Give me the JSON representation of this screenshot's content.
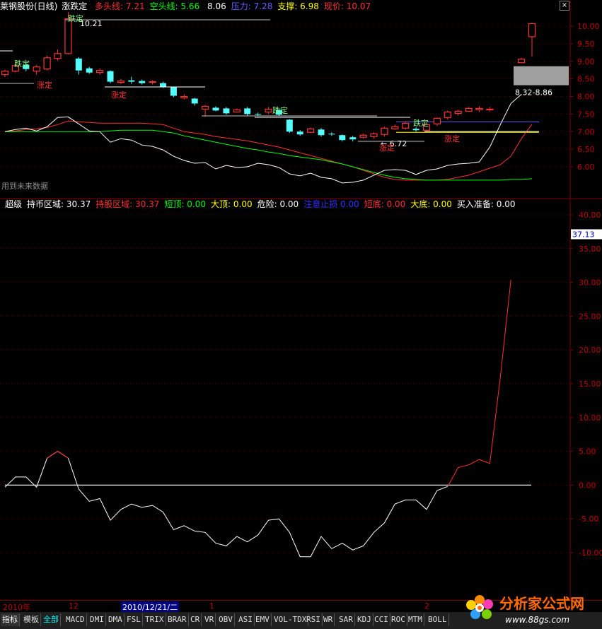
{
  "header": {
    "title": "莱钢股份(日线)",
    "indicator": "涨跌定",
    "items": [
      {
        "label": "多头线:",
        "value": "7.21",
        "color": "#ff3030"
      },
      {
        "label": "空头线:",
        "value": "5.66",
        "color": "#00ff00"
      },
      {
        "label": "",
        "value": "8.06",
        "color": "#ffffff"
      },
      {
        "label": "压力:",
        "value": "7.28",
        "color": "#6060ff"
      },
      {
        "label": "支撑:",
        "value": "6.98",
        "color": "#ffff00"
      },
      {
        "label": "现价:",
        "value": "10.07",
        "color": "#ff3030"
      }
    ],
    "close_icon": "close-icon"
  },
  "lower_header": {
    "items": [
      {
        "label": "超级",
        "value": "",
        "color": "#ffffff"
      },
      {
        "label": "持币区域:",
        "value": "30.37",
        "color": "#ffffff"
      },
      {
        "label": "持股区域:",
        "value": "30.37",
        "color": "#ff3030"
      },
      {
        "label": "短顶:",
        "value": "0.00",
        "color": "#00ff00"
      },
      {
        "label": "大顶:",
        "value": "0.00",
        "color": "#ffff00"
      },
      {
        "label": "危险:",
        "value": "0.00",
        "color": "#ffffff"
      },
      {
        "label": "注意止损",
        "value": "0.00",
        "color": "#3030ff"
      },
      {
        "label": "短底:",
        "value": "0.00",
        "color": "#ff3030"
      },
      {
        "label": "大底:",
        "value": "0.00",
        "color": "#ffff00"
      },
      {
        "label": "买入准备:",
        "value": "0.00",
        "color": "#ffffff"
      }
    ]
  },
  "upper_labels": {
    "high_label": "10.21",
    "low_label": "6.72",
    "range_label": "8.32-8.86",
    "future_note": "用到未来数据",
    "up_fix": "涨定",
    "down_fix": "跌定"
  },
  "time_axis": {
    "labels": [
      "2010年",
      "12",
      "2010/12/21/二",
      "1",
      "2"
    ]
  },
  "tabs": [
    "指标",
    "模板",
    "全部",
    "MACD",
    "DMI",
    "DMA",
    "FSL",
    "TRIX",
    "BRAR",
    "CR",
    "VR",
    "OBV",
    "ASI",
    "EMV",
    "VOL-TDX",
    "RSI",
    "WR",
    "SAR",
    "KDJ",
    "CCI",
    "ROC",
    "MTM",
    "BOLL"
  ],
  "watermark": {
    "text": "分析家公式网",
    "url": "www.88gs.com"
  },
  "chart_data": [
    {
      "type": "candlestick",
      "title": "莱钢股份(日线)",
      "ylim": [
        5.3,
        10.45
      ],
      "yticks": [
        "10.00",
        "9.50",
        "9.00",
        "8.50",
        "8.00",
        "7.50",
        "7.00",
        "6.50",
        "6.00"
      ],
      "candles": [
        {
          "o": 8.62,
          "c": 8.72,
          "h": 8.76,
          "l": 8.55
        },
        {
          "o": 8.72,
          "c": 8.88,
          "h": 8.94,
          "l": 8.68
        },
        {
          "o": 8.9,
          "c": 8.78,
          "h": 8.96,
          "l": 8.72
        },
        {
          "o": 8.72,
          "c": 8.84,
          "h": 8.9,
          "l": 8.62
        },
        {
          "o": 8.78,
          "c": 9.1,
          "h": 9.16,
          "l": 8.74
        },
        {
          "o": 9.08,
          "c": 9.22,
          "h": 9.34,
          "l": 9.02
        },
        {
          "o": 9.22,
          "c": 10.21,
          "h": 10.4,
          "l": 9.2
        },
        {
          "o": 9.08,
          "c": 8.74,
          "h": 9.12,
          "l": 8.62
        },
        {
          "o": 8.8,
          "c": 8.68,
          "h": 8.84,
          "l": 8.64
        },
        {
          "o": 8.68,
          "c": 8.74,
          "h": 8.8,
          "l": 8.62
        },
        {
          "o": 8.72,
          "c": 8.42,
          "h": 8.74,
          "l": 8.38
        },
        {
          "o": 8.4,
          "c": 8.44,
          "h": 8.5,
          "l": 8.36
        },
        {
          "o": 8.46,
          "c": 8.42,
          "h": 8.56,
          "l": 8.36
        },
        {
          "o": 8.44,
          "c": 8.38,
          "h": 8.48,
          "l": 8.34
        },
        {
          "o": 8.4,
          "c": 8.42,
          "h": 8.46,
          "l": 8.34
        },
        {
          "o": 8.38,
          "c": 8.28,
          "h": 8.42,
          "l": 8.24
        },
        {
          "o": 8.26,
          "c": 8.02,
          "h": 8.28,
          "l": 7.98
        },
        {
          "o": 7.96,
          "c": 8.0,
          "h": 8.06,
          "l": 7.92
        },
        {
          "o": 7.94,
          "c": 7.8,
          "h": 7.96,
          "l": 7.74
        },
        {
          "o": 7.64,
          "c": 7.72,
          "h": 7.76,
          "l": 7.42
        },
        {
          "o": 7.68,
          "c": 7.6,
          "h": 7.72,
          "l": 7.58
        },
        {
          "o": 7.66,
          "c": 7.52,
          "h": 7.7,
          "l": 7.48
        },
        {
          "o": 7.56,
          "c": 7.62,
          "h": 7.66,
          "l": 7.54
        },
        {
          "o": 7.66,
          "c": 7.5,
          "h": 7.7,
          "l": 7.46
        },
        {
          "o": 7.5,
          "c": 7.48,
          "h": 7.54,
          "l": 7.44
        },
        {
          "o": 7.56,
          "c": 7.64,
          "h": 7.7,
          "l": 7.5
        },
        {
          "o": 7.62,
          "c": 7.48,
          "h": 7.64,
          "l": 7.44
        },
        {
          "o": 7.34,
          "c": 7.0,
          "h": 7.36,
          "l": 6.96
        },
        {
          "o": 7.0,
          "c": 6.92,
          "h": 7.04,
          "l": 6.88
        },
        {
          "o": 6.98,
          "c": 7.08,
          "h": 7.12,
          "l": 6.96
        },
        {
          "o": 7.06,
          "c": 6.9,
          "h": 7.1,
          "l": 6.86
        },
        {
          "o": 6.94,
          "c": 6.92,
          "h": 6.98,
          "l": 6.88
        },
        {
          "o": 6.9,
          "c": 6.76,
          "h": 6.92,
          "l": 6.72
        },
        {
          "o": 6.84,
          "c": 6.78,
          "h": 6.88,
          "l": 6.72
        },
        {
          "o": 6.84,
          "c": 6.9,
          "h": 6.94,
          "l": 6.8
        },
        {
          "o": 6.86,
          "c": 6.94,
          "h": 6.98,
          "l": 6.8
        },
        {
          "o": 6.92,
          "c": 7.1,
          "h": 7.14,
          "l": 6.86
        },
        {
          "o": 7.08,
          "c": 7.14,
          "h": 7.2,
          "l": 7.04
        },
        {
          "o": 7.1,
          "c": 7.24,
          "h": 7.3,
          "l": 7.06
        },
        {
          "o": 7.08,
          "c": 7.04,
          "h": 7.12,
          "l": 7.0
        },
        {
          "o": 7.04,
          "c": 7.2,
          "h": 7.28,
          "l": 7.0
        },
        {
          "o": 7.22,
          "c": 7.38,
          "h": 7.4,
          "l": 7.16
        },
        {
          "o": 7.4,
          "c": 7.56,
          "h": 7.6,
          "l": 7.34
        },
        {
          "o": 7.52,
          "c": 7.58,
          "h": 7.62,
          "l": 7.46
        },
        {
          "o": 7.58,
          "c": 7.66,
          "h": 7.7,
          "l": 7.56
        },
        {
          "o": 7.62,
          "c": 7.66,
          "h": 7.72,
          "l": 7.56
        },
        {
          "o": 7.64,
          "c": 7.64,
          "h": 7.7,
          "l": 7.58
        },
        {
          "o": null,
          "c": null,
          "h": null,
          "l": null
        },
        {
          "o": null,
          "c": null,
          "h": null,
          "l": null
        },
        {
          "o": 8.96,
          "c": 9.06,
          "h": 9.1,
          "l": 8.94
        },
        {
          "o": 9.7,
          "c": 10.07,
          "h": 10.1,
          "l": 9.14
        }
      ],
      "series": [
        {
          "name": "多头线",
          "color": "#ff3030",
          "values": [
            7.0,
            7.02,
            7.06,
            7.08,
            7.12,
            7.2,
            7.3,
            7.28,
            7.26,
            7.24,
            7.24,
            7.24,
            7.24,
            7.24,
            7.22,
            7.2,
            7.1,
            7.0,
            6.96,
            6.92,
            6.86,
            6.82,
            6.78,
            6.74,
            6.68,
            6.62,
            6.56,
            6.48,
            6.4,
            6.32,
            6.24,
            6.16,
            6.08,
            6.0,
            5.9,
            5.8,
            5.7,
            5.64,
            5.62,
            5.62,
            5.62,
            5.62,
            5.64,
            5.7,
            5.76,
            5.86,
            5.96,
            6.06,
            6.3,
            6.8,
            7.21
          ]
        },
        {
          "name": "空头线",
          "color": "#00ff00",
          "values": [
            7.0,
            7.0,
            7.0,
            7.0,
            7.0,
            7.0,
            7.0,
            7.0,
            7.0,
            7.0,
            7.02,
            7.04,
            7.04,
            7.04,
            7.04,
            7.0,
            6.96,
            6.88,
            6.82,
            6.76,
            6.7,
            6.64,
            6.58,
            6.52,
            6.48,
            6.42,
            6.38,
            6.32,
            6.28,
            6.24,
            6.2,
            6.14,
            6.08,
            6.0,
            5.92,
            5.84,
            5.76,
            5.7,
            5.66,
            5.64,
            5.62,
            5.62,
            5.62,
            5.62,
            5.62,
            5.62,
            5.62,
            5.62,
            5.64,
            5.64,
            5.66
          ]
        },
        {
          "name": "",
          "color": "#ffffff",
          "values": [
            7.0,
            7.06,
            7.1,
            7.02,
            7.14,
            7.4,
            7.42,
            7.22,
            7.02,
            7.0,
            6.7,
            6.8,
            6.76,
            6.62,
            6.58,
            6.48,
            6.3,
            6.18,
            6.1,
            6.12,
            5.94,
            6.04,
            5.98,
            6.0,
            6.1,
            6.06,
            5.98,
            5.8,
            5.74,
            5.82,
            5.7,
            5.66,
            5.54,
            5.56,
            5.62,
            5.76,
            5.9,
            5.92,
            5.9,
            5.78,
            5.9,
            5.94,
            6.04,
            6.08,
            6.1,
            6.14,
            6.56,
            7.2,
            7.8,
            8.06
          ]
        }
      ],
      "levels": [
        {
          "name": "压力",
          "value": 7.28,
          "color": "#6060ff"
        },
        {
          "name": "支撑",
          "value": 6.98,
          "color": "#ffff00"
        }
      ],
      "forecast_box": {
        "low": 8.32,
        "high": 8.86
      }
    },
    {
      "type": "line",
      "title": "超级",
      "ylim": [
        -17,
        44
      ],
      "yticks": [
        "40.00",
        "35.00",
        "30.00",
        "25.00",
        "20.00",
        "15.00",
        "10.00",
        "5.00",
        "0.00",
        "-5.00",
        "-10.00"
      ],
      "current_value": "37.13",
      "series": [
        {
          "name": "持币区域",
          "color": "#ffffff",
          "values": [
            -0.3,
            1.2,
            1.2,
            -0.3,
            4.0,
            5.0,
            4.0,
            -0.6,
            -2.4,
            -2.0,
            -5.2,
            -3.6,
            -2.8,
            -3.3,
            -3.0,
            -4.0,
            -6.6,
            -6.0,
            -6.8,
            -7.0,
            -8.6,
            -9.0,
            -7.6,
            -8.4,
            -7.4,
            -5.2,
            -5.0,
            -7.0,
            -10.6,
            -10.6,
            -7.6,
            -9.4,
            -8.6,
            -9.6,
            -9.0,
            -7.0,
            -5.6,
            -2.8,
            -2.2,
            -2.2,
            -3.6,
            -0.8,
            -0.2,
            null,
            null,
            null,
            null,
            null,
            null,
            null
          ]
        },
        {
          "name": "持股区域",
          "color": "#ff3030",
          "values": [
            null,
            null,
            null,
            null,
            4.0,
            5.0,
            4.0,
            null,
            null,
            null,
            null,
            null,
            null,
            null,
            null,
            null,
            null,
            null,
            null,
            null,
            null,
            null,
            null,
            null,
            null,
            null,
            null,
            null,
            null,
            null,
            null,
            null,
            null,
            null,
            null,
            null,
            null,
            null,
            null,
            null,
            null,
            null,
            -0.2,
            2.6,
            3.0,
            3.8,
            3.2,
            16.0,
            30.37
          ]
        }
      ],
      "zero_line": 0
    }
  ]
}
